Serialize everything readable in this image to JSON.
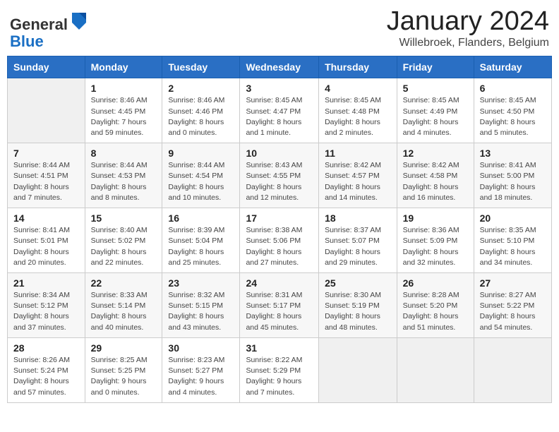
{
  "header": {
    "logo_general": "General",
    "logo_blue": "Blue",
    "month_title": "January 2024",
    "location": "Willebroek, Flanders, Belgium"
  },
  "days_of_week": [
    "Sunday",
    "Monday",
    "Tuesday",
    "Wednesday",
    "Thursday",
    "Friday",
    "Saturday"
  ],
  "weeks": [
    [
      {
        "day": "",
        "info": ""
      },
      {
        "day": "1",
        "info": "Sunrise: 8:46 AM\nSunset: 4:45 PM\nDaylight: 7 hours\nand 59 minutes."
      },
      {
        "day": "2",
        "info": "Sunrise: 8:46 AM\nSunset: 4:46 PM\nDaylight: 8 hours\nand 0 minutes."
      },
      {
        "day": "3",
        "info": "Sunrise: 8:45 AM\nSunset: 4:47 PM\nDaylight: 8 hours\nand 1 minute."
      },
      {
        "day": "4",
        "info": "Sunrise: 8:45 AM\nSunset: 4:48 PM\nDaylight: 8 hours\nand 2 minutes."
      },
      {
        "day": "5",
        "info": "Sunrise: 8:45 AM\nSunset: 4:49 PM\nDaylight: 8 hours\nand 4 minutes."
      },
      {
        "day": "6",
        "info": "Sunrise: 8:45 AM\nSunset: 4:50 PM\nDaylight: 8 hours\nand 5 minutes."
      }
    ],
    [
      {
        "day": "7",
        "info": "Sunrise: 8:44 AM\nSunset: 4:51 PM\nDaylight: 8 hours\nand 7 minutes."
      },
      {
        "day": "8",
        "info": "Sunrise: 8:44 AM\nSunset: 4:53 PM\nDaylight: 8 hours\nand 8 minutes."
      },
      {
        "day": "9",
        "info": "Sunrise: 8:44 AM\nSunset: 4:54 PM\nDaylight: 8 hours\nand 10 minutes."
      },
      {
        "day": "10",
        "info": "Sunrise: 8:43 AM\nSunset: 4:55 PM\nDaylight: 8 hours\nand 12 minutes."
      },
      {
        "day": "11",
        "info": "Sunrise: 8:42 AM\nSunset: 4:57 PM\nDaylight: 8 hours\nand 14 minutes."
      },
      {
        "day": "12",
        "info": "Sunrise: 8:42 AM\nSunset: 4:58 PM\nDaylight: 8 hours\nand 16 minutes."
      },
      {
        "day": "13",
        "info": "Sunrise: 8:41 AM\nSunset: 5:00 PM\nDaylight: 8 hours\nand 18 minutes."
      }
    ],
    [
      {
        "day": "14",
        "info": "Sunrise: 8:41 AM\nSunset: 5:01 PM\nDaylight: 8 hours\nand 20 minutes."
      },
      {
        "day": "15",
        "info": "Sunrise: 8:40 AM\nSunset: 5:02 PM\nDaylight: 8 hours\nand 22 minutes."
      },
      {
        "day": "16",
        "info": "Sunrise: 8:39 AM\nSunset: 5:04 PM\nDaylight: 8 hours\nand 25 minutes."
      },
      {
        "day": "17",
        "info": "Sunrise: 8:38 AM\nSunset: 5:06 PM\nDaylight: 8 hours\nand 27 minutes."
      },
      {
        "day": "18",
        "info": "Sunrise: 8:37 AM\nSunset: 5:07 PM\nDaylight: 8 hours\nand 29 minutes."
      },
      {
        "day": "19",
        "info": "Sunrise: 8:36 AM\nSunset: 5:09 PM\nDaylight: 8 hours\nand 32 minutes."
      },
      {
        "day": "20",
        "info": "Sunrise: 8:35 AM\nSunset: 5:10 PM\nDaylight: 8 hours\nand 34 minutes."
      }
    ],
    [
      {
        "day": "21",
        "info": "Sunrise: 8:34 AM\nSunset: 5:12 PM\nDaylight: 8 hours\nand 37 minutes."
      },
      {
        "day": "22",
        "info": "Sunrise: 8:33 AM\nSunset: 5:14 PM\nDaylight: 8 hours\nand 40 minutes."
      },
      {
        "day": "23",
        "info": "Sunrise: 8:32 AM\nSunset: 5:15 PM\nDaylight: 8 hours\nand 43 minutes."
      },
      {
        "day": "24",
        "info": "Sunrise: 8:31 AM\nSunset: 5:17 PM\nDaylight: 8 hours\nand 45 minutes."
      },
      {
        "day": "25",
        "info": "Sunrise: 8:30 AM\nSunset: 5:19 PM\nDaylight: 8 hours\nand 48 minutes."
      },
      {
        "day": "26",
        "info": "Sunrise: 8:28 AM\nSunset: 5:20 PM\nDaylight: 8 hours\nand 51 minutes."
      },
      {
        "day": "27",
        "info": "Sunrise: 8:27 AM\nSunset: 5:22 PM\nDaylight: 8 hours\nand 54 minutes."
      }
    ],
    [
      {
        "day": "28",
        "info": "Sunrise: 8:26 AM\nSunset: 5:24 PM\nDaylight: 8 hours\nand 57 minutes."
      },
      {
        "day": "29",
        "info": "Sunrise: 8:25 AM\nSunset: 5:25 PM\nDaylight: 9 hours\nand 0 minutes."
      },
      {
        "day": "30",
        "info": "Sunrise: 8:23 AM\nSunset: 5:27 PM\nDaylight: 9 hours\nand 4 minutes."
      },
      {
        "day": "31",
        "info": "Sunrise: 8:22 AM\nSunset: 5:29 PM\nDaylight: 9 hours\nand 7 minutes."
      },
      {
        "day": "",
        "info": ""
      },
      {
        "day": "",
        "info": ""
      },
      {
        "day": "",
        "info": ""
      }
    ]
  ]
}
